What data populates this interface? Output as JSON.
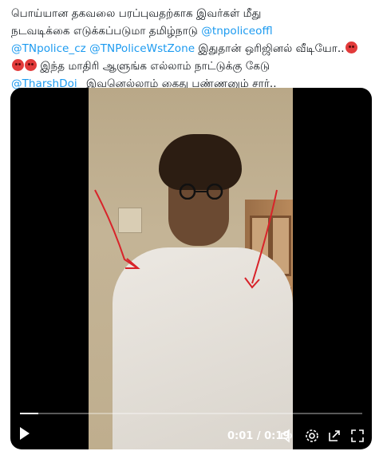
{
  "tweet": {
    "line1": "பொய்யான தகவலை பரப்புவதற்காக இவர்கள் மீது",
    "line2_text": "நடவடிக்கை எடுக்கப்படுமா தமிழ்நாடு ",
    "line2_mention": "@tnpoliceoffl",
    "line3_mention1": "@TNpolice_cz",
    "line3_mention2": "@TNPoliceWstZone",
    "line3_text": " இதுதான் ஒரிஜினல் வீடியோ..",
    "line4_text": " இந்த மாதிரி ஆளுங்க எல்லாம் நாட்டுக்கு கேடு",
    "line5_mention": "@TharshDoi_",
    "line5_text": " இவனெல்லாம் கைது பண்ணனும் சார்.."
  },
  "video": {
    "time_display": "0:01 / 0:19",
    "progress_fraction": 0.053
  },
  "icons": {
    "emoji": "angry-face-emoji",
    "play": "play-icon",
    "volume": "volume-icon",
    "settings": "gear-icon",
    "share": "share-icon",
    "fullscreen": "fullscreen-icon"
  }
}
